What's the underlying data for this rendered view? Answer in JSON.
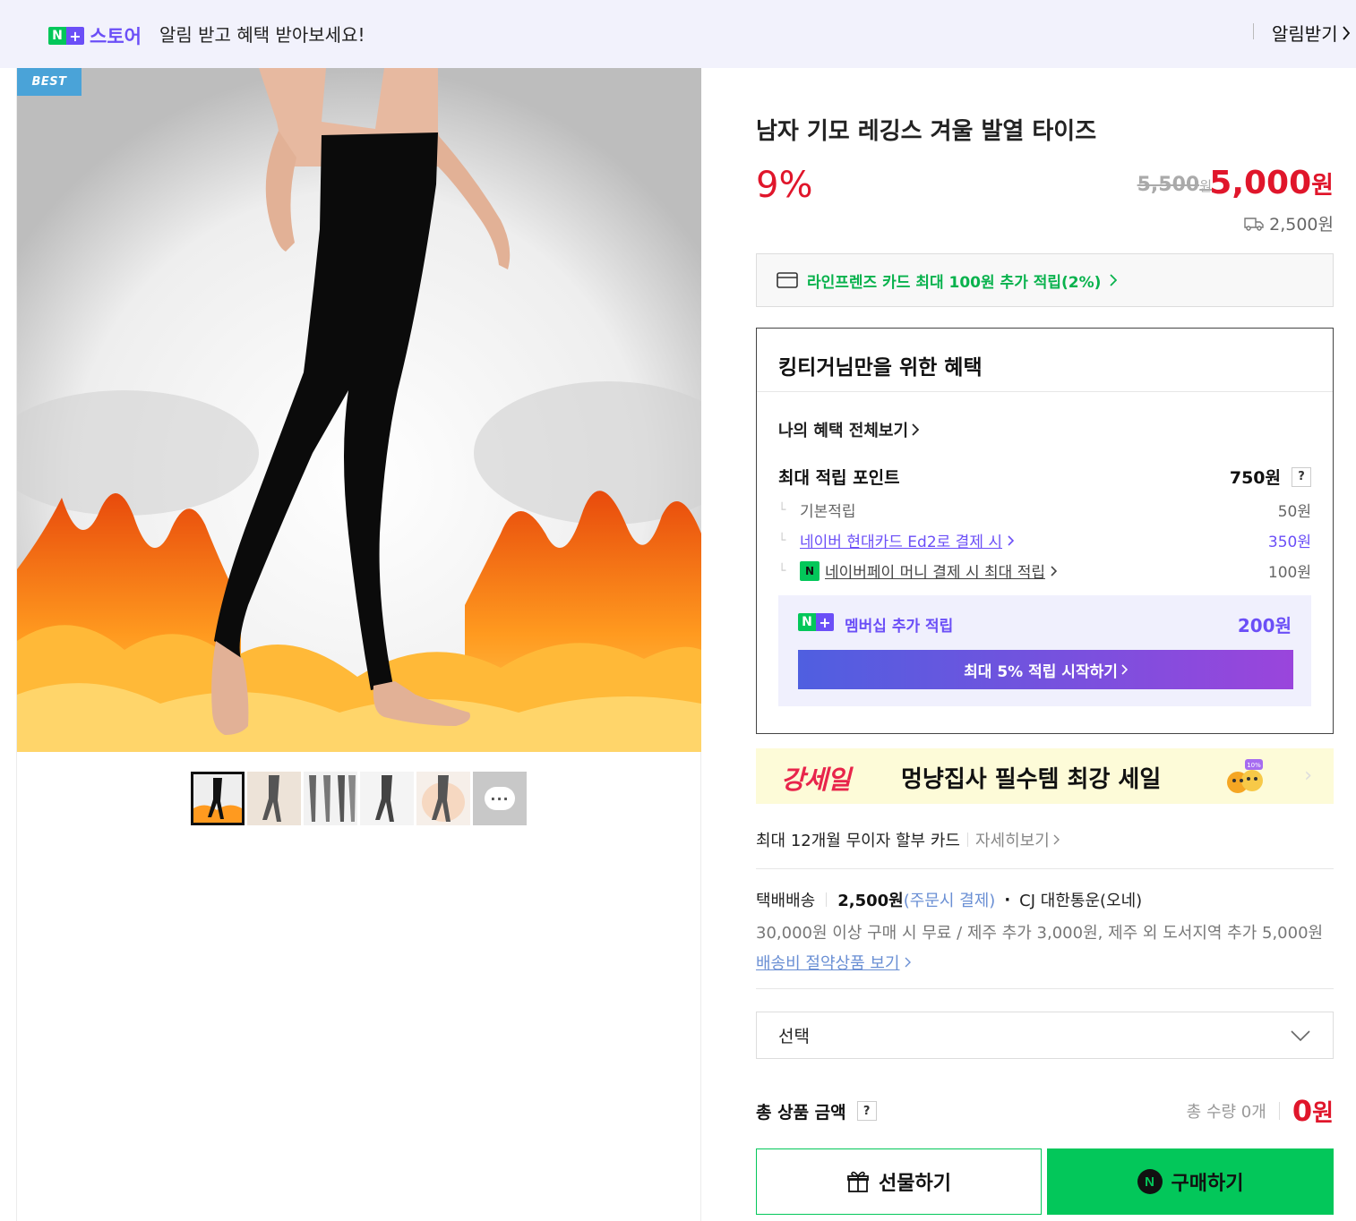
{
  "banner": {
    "logo_n": "N",
    "logo_plus": "+",
    "logo_store": "스토어",
    "message": "알림 받고 혜택 받아보세요!",
    "button": "알림받기"
  },
  "gallery": {
    "badge": "BEST",
    "thumbnail_count": 6,
    "active_thumbnail": 1,
    "more_bubble": "···"
  },
  "product": {
    "title": "남자 기모 레깅스 겨울 발열 타이즈",
    "discount": "9%",
    "original_price": "5,500",
    "original_unit": "원",
    "sale_price": "5,000",
    "sale_unit": "원",
    "shipping_fee": "2,500원"
  },
  "card_promo": {
    "text": "라인프렌즈 카드 최대 100원 추가 적립(2%)"
  },
  "benefits": {
    "heading": "킹티거님만을 위한 혜택",
    "my_benefits_link": "나의 혜택 전체보기",
    "max_points_label": "최대 적립 포인트",
    "max_points_value": "750원",
    "help": "?",
    "rows": [
      {
        "label": "기본적립",
        "value": "50원"
      },
      {
        "label": "네이버 현대카드 Ed2로 결제 시",
        "value": "350원"
      },
      {
        "label": "네이버페이 머니 결제 시 최대 적립",
        "value": "100원"
      }
    ],
    "membership": {
      "label": "멤버십 추가 적립",
      "value": "200원",
      "button": "최대 5% 적립 시작하기"
    }
  },
  "ad": {
    "brand": "강세일",
    "text": "멍냥집사 필수템 최강 세일",
    "tag": "10%"
  },
  "installment": {
    "text": "최대 12개월 무이자 할부 카드",
    "more": "자세히보기"
  },
  "shipping": {
    "method": "택배배송",
    "price": "2,500원",
    "pay_note": "(주문시 결제)",
    "carrier": "CJ 대한통운(오네)",
    "condition": "30,000원 이상 구매 시 무료 / 제주 추가 3,000원, 제주 외 도서지역 추가 5,000원",
    "saving_link": "배송비 절약상품 보기"
  },
  "option_select": {
    "placeholder": "선택"
  },
  "total": {
    "label": "총 상품 금액",
    "help": "?",
    "quantity": "총 수량 0개",
    "price": "0",
    "unit": "원"
  },
  "actions": {
    "gift": "선물하기",
    "buy": "구매하기",
    "buy_icon": "N"
  },
  "colors": {
    "accent_red": "#e0162b",
    "naver_green": "#03c75a",
    "purple": "#6b4ff7"
  }
}
